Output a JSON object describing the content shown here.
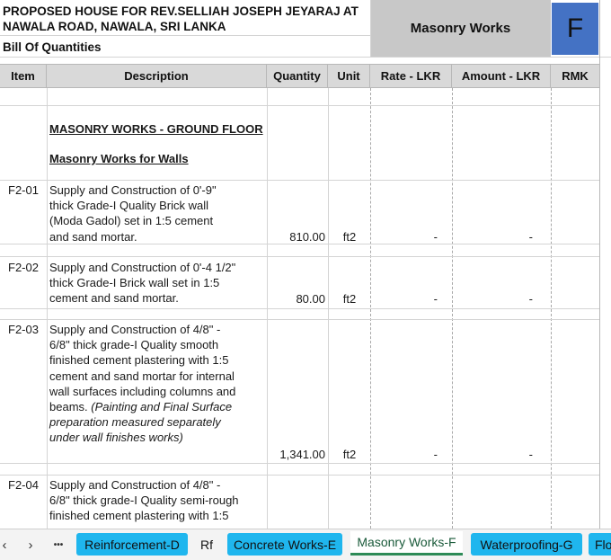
{
  "header": {
    "project_line1": "PROPOSED HOUSE FOR REV.SELLIAH JOSEPH JEYARAJ AT",
    "project_line2": "NAWALA ROAD, NAWALA, SRI LANKA",
    "boq": "Bill Of Quantities",
    "section_title": "Masonry Works",
    "section_letter": "F"
  },
  "columns": {
    "item": "Item",
    "description": "Description",
    "quantity": "Quantity",
    "unit": "Unit",
    "rate": "Rate - LKR",
    "amount": "Amount - LKR",
    "rmk": "RMK"
  },
  "sections": {
    "ground_floor": "MASONRY WORKS - GROUND FLOOR",
    "walls": "Masonry Works for Walls"
  },
  "rows": [
    {
      "item": "F2-01",
      "desc": [
        "Supply and Construction of 0'-9\"",
        "thick Grade-I Quality Brick wall",
        "(Moda Gadol) set in 1:5 cement",
        "and sand mortar."
      ],
      "qty": "810.00",
      "unit": "ft2",
      "rate": "-",
      "amount": "-"
    },
    {
      "item": "F2-02",
      "desc": [
        "Supply and Construction of 0'-4 1/2\"",
        "thick Grade-I Brick wall set in 1:5",
        "cement and sand mortar."
      ],
      "qty": "80.00",
      "unit": "ft2",
      "rate": "-",
      "amount": "-"
    },
    {
      "item": "F2-03",
      "desc": [
        "Supply and Construction of  4/8\" -",
        "6/8\"  thick grade-I Quality smooth",
        "finished cement plastering with 1:5",
        "cement and sand mortar for internal",
        "wall surfaces  including columns and",
        "beams."
      ],
      "note": [
        "(Painting and Final Surface",
        "preparation measured separately",
        "under wall finishes works)"
      ],
      "qty": "1,341.00",
      "unit": "ft2",
      "rate": "-",
      "amount": "-"
    },
    {
      "item": "F2-04",
      "desc": [
        "Supply and Construction of  4/8\" -",
        "6/8\"  thick grade-I Quality semi-rough",
        "finished cement plastering with 1:5"
      ]
    }
  ],
  "tabs": {
    "prev_icon": "chevron-left-icon",
    "next_icon": "chevron-right-icon",
    "more_icon": "more-icon",
    "prev": "‹",
    "next": "›",
    "more": "•••",
    "items": [
      {
        "label": "Reinforcement-D",
        "style": "blue"
      },
      {
        "label": "Rf",
        "style": "plain"
      },
      {
        "label": "Concrete Works-E",
        "style": "blue"
      },
      {
        "label": "Masonry Works-F",
        "style": "active"
      },
      {
        "label": "Waterproofing-G",
        "style": "blue"
      },
      {
        "label": "Flo",
        "style": "blue"
      }
    ]
  },
  "colors": {
    "header_gray": "#c8c8c8",
    "letter_blue": "#4472c4",
    "tab_blue": "#1fb6ee",
    "active_green": "#2e8b57"
  }
}
